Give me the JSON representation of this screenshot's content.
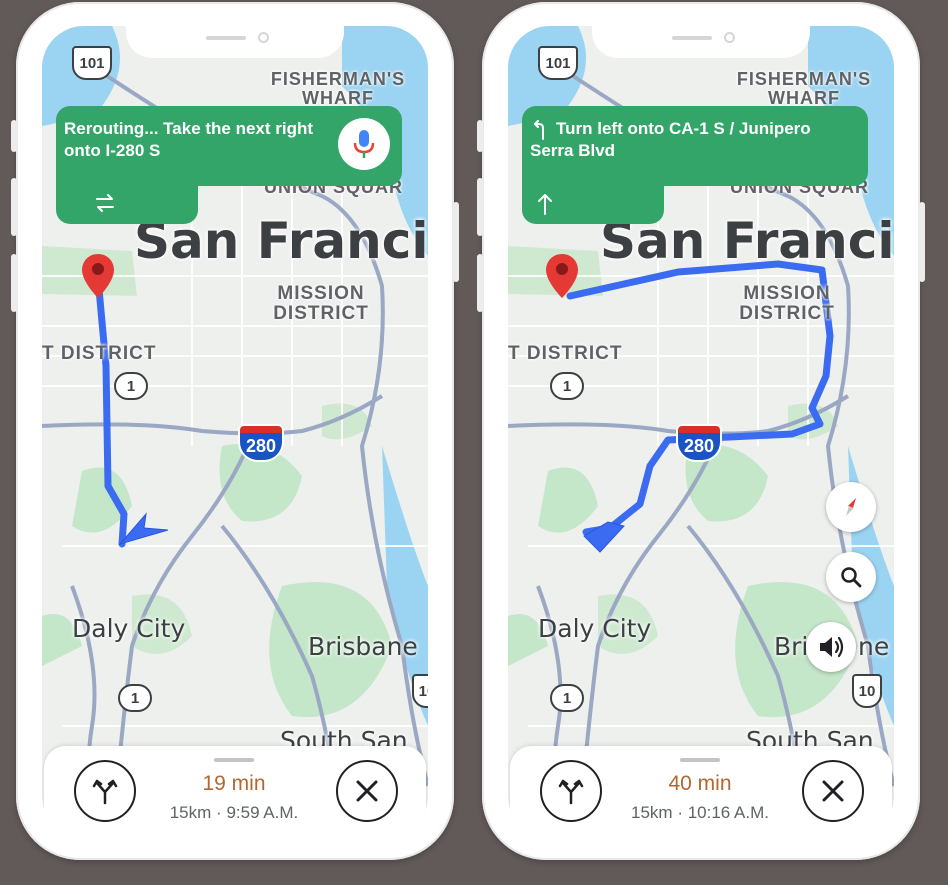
{
  "colors": {
    "background": "#625a58",
    "nav_banner": "#34a568",
    "route": "#3b6bf0",
    "eta_time": "#b1672e",
    "destination_pin": "#e53935"
  },
  "map_labels": {
    "highway_101": "101",
    "fishermans_wharf": "FISHERMAN'S WHARF",
    "union_square": "UNION SQUAR",
    "city": "San Francis",
    "mission_district": "MISSION DISTRICT",
    "district_left": "T DISTRICT",
    "route_1": "1",
    "interstate_280": "280",
    "daly_city": "Daly City",
    "brisbane": "Brisbane",
    "brisbane_partial": "Bri",
    "brisbane_tail": "ne",
    "south_san": "South San",
    "right_shield": "10"
  },
  "phones": [
    {
      "nav_instruction": "Rerouting... Take the next right onto I-280 S",
      "nav_icon": "reroute-icon",
      "mic_icon": "mic-icon",
      "eta_time": "19 min",
      "eta_distance": "15km",
      "eta_separator": "·",
      "eta_arrival": "9:59 A.M."
    },
    {
      "nav_instruction": "Turn left onto CA-1 S / Junipero Serra Blvd",
      "nav_turn_icon": "turn-left-icon",
      "nav_next_icon": "arrow-up-icon",
      "eta_time": "40 min",
      "eta_distance": "15km",
      "eta_separator": "·",
      "eta_arrival": "10:16 A.M.",
      "fab_icons": [
        "compass-icon",
        "search-icon",
        "volume-icon"
      ]
    }
  ]
}
